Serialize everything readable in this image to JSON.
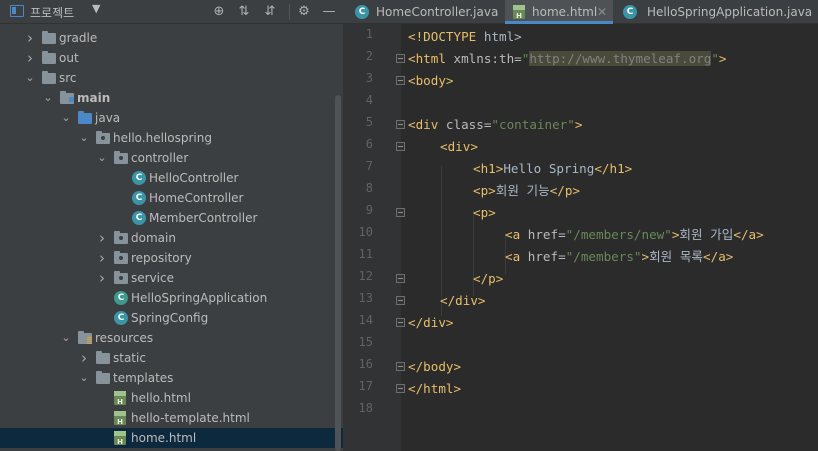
{
  "project_panel": {
    "title": "프로젝트",
    "caret": "▼",
    "tools": [
      "⊕",
      "⇅",
      "⇵",
      "⚙",
      "—"
    ]
  },
  "tree": [
    {
      "label": "gradle",
      "arrow": "›",
      "icon": "folder-icon"
    },
    {
      "label": "out",
      "arrow": "›",
      "icon": "folder-icon"
    },
    {
      "label": "src",
      "arrow": "⌄",
      "icon": "folder-icon"
    },
    {
      "label": "main",
      "arrow": "⌄",
      "icon": "module-folder-icon"
    },
    {
      "label": "java",
      "arrow": "⌄",
      "icon": "source-folder-icon"
    },
    {
      "label": "hello.hellospring",
      "arrow": "⌄",
      "icon": "package-icon"
    },
    {
      "label": "controller",
      "arrow": "⌄",
      "icon": "package-icon"
    },
    {
      "label": "HelloController",
      "arrow": "",
      "icon": "class-icon"
    },
    {
      "label": "HomeController",
      "arrow": "",
      "icon": "class-icon"
    },
    {
      "label": "MemberController",
      "arrow": "",
      "icon": "class-icon"
    },
    {
      "label": "domain",
      "arrow": "›",
      "icon": "package-icon"
    },
    {
      "label": "repository",
      "arrow": "›",
      "icon": "package-icon"
    },
    {
      "label": "service",
      "arrow": "›",
      "icon": "package-icon"
    },
    {
      "label": "HelloSpringApplication",
      "arrow": "",
      "icon": "spring-class-icon"
    },
    {
      "label": "SpringConfig",
      "arrow": "",
      "icon": "class-icon"
    },
    {
      "label": "resources",
      "arrow": "⌄",
      "icon": "resources-folder-icon"
    },
    {
      "label": "static",
      "arrow": "›",
      "icon": "folder-icon"
    },
    {
      "label": "templates",
      "arrow": "⌄",
      "icon": "folder-icon"
    },
    {
      "label": "hello.html",
      "arrow": "",
      "icon": "html-file-icon"
    },
    {
      "label": "hello-template.html",
      "arrow": "",
      "icon": "html-file-icon"
    },
    {
      "label": "home.html",
      "arrow": "",
      "icon": "html-file-icon",
      "selected": true
    }
  ],
  "tabs": [
    {
      "label": "HomeController.java",
      "icon": "class-icon",
      "active": false
    },
    {
      "label": "home.html",
      "icon": "html-file-icon",
      "active": true
    },
    {
      "label": "HelloSpringApplication.java",
      "icon": "spring-class-icon",
      "active": false
    }
  ],
  "tab_close": "✕",
  "line_numbers": [
    "1",
    "2",
    "3",
    "4",
    "5",
    "6",
    "7",
    "8",
    "9",
    "10",
    "11",
    "12",
    "13",
    "14",
    "15",
    "16",
    "17",
    "18"
  ],
  "code": {
    "l1_doctype": "<!DOCTYPE",
    "l1_html": " html>",
    "l2_open": "<html",
    "l2_attr": " xmlns:th=",
    "l2_q1": "\"",
    "l2_url": "http://www.thymeleaf.org",
    "l2_q2": "\"",
    "l2_close": ">",
    "l3": "<body>",
    "l5_open": "<div",
    "l5_attr": " class=",
    "l5_val": "\"container\"",
    "l5_close": ">",
    "l6": "<div>",
    "l7_open": "<h1>",
    "l7_text": "Hello Spring",
    "l7_close": "</h1>",
    "l8_open": "<p>",
    "l8_text": "회원 기능",
    "l8_close": "</p>",
    "l9": "<p>",
    "l10_open": "<a",
    "l10_attr": " href=",
    "l10_val": "\"/members/new\"",
    "l10_gt": ">",
    "l10_text": "회원 가입",
    "l10_close": "</a>",
    "l11_open": "<a",
    "l11_attr": " href=",
    "l11_val": "\"/members\"",
    "l11_gt": ">",
    "l11_text": "회원 목록",
    "l11_close": "</a>",
    "l12": "</p>",
    "l13": "</div>",
    "l14": "</div>",
    "l16": "</body>",
    "l17": "</html>"
  }
}
